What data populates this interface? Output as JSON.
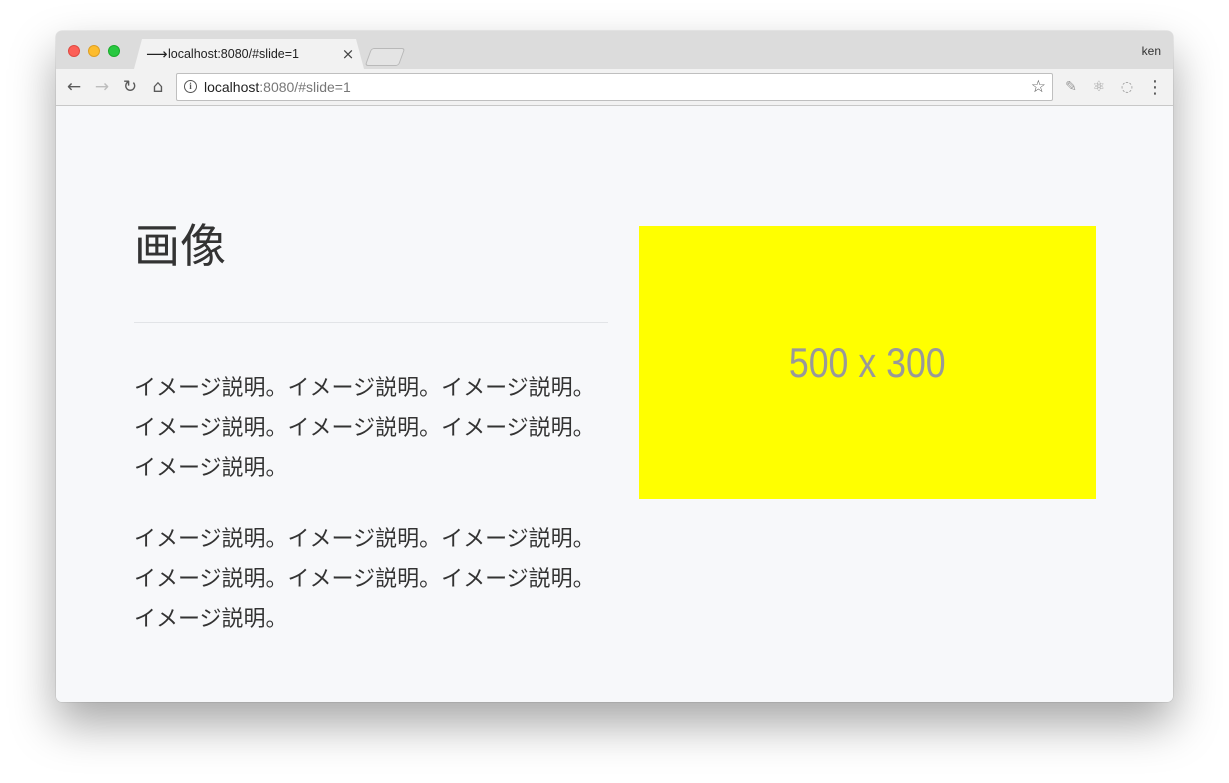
{
  "browser": {
    "tab": {
      "favicon": "⟶",
      "title": "localhost:8080/#slide=1",
      "close": "×"
    },
    "profile": "ken",
    "address": {
      "host": "localhost",
      "rest": ":8080/#slide=1"
    },
    "icons": {
      "back": "←",
      "forward": "→",
      "reload": "↻",
      "home": "⌂",
      "bookmark": "☆",
      "menu": "⋮",
      "ext1": "✎",
      "ext2": "⚛",
      "ext3": "◌"
    }
  },
  "slide": {
    "heading": "画像",
    "paragraphs": [
      "イメージ説明。イメージ説明。イメージ説明。イメージ説明。イメージ説明。イメージ説明。イメージ説明。",
      "イメージ説明。イメージ説明。イメージ説明。イメージ説明。イメージ説明。イメージ説明。イメージ説明。"
    ],
    "image": {
      "label": "500 x 300",
      "background": "#ffff00",
      "text_color": "#999999"
    }
  }
}
